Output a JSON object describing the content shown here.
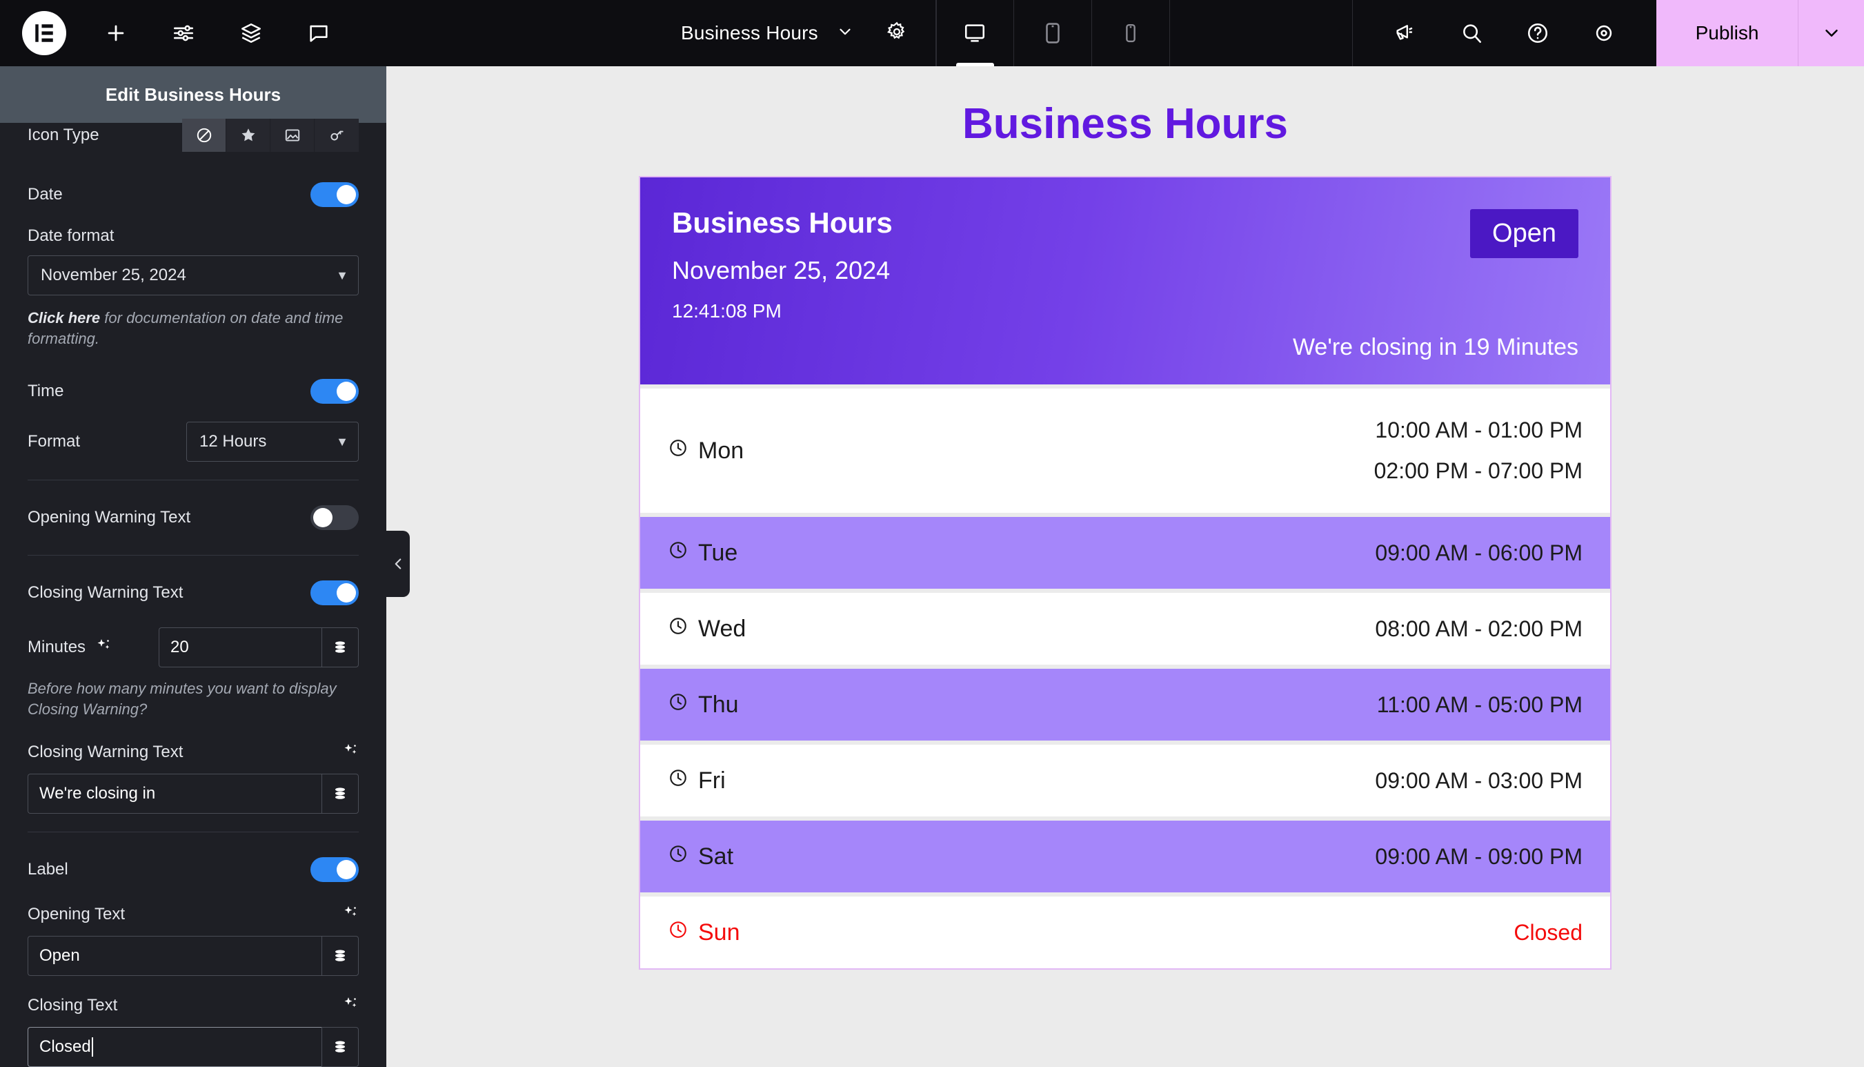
{
  "topbar": {
    "logo_icon": "elementor-logo-icon",
    "left_icons": [
      {
        "name": "add-element-icon",
        "glyph": "plus"
      },
      {
        "name": "site-settings-icon",
        "glyph": "sliders"
      },
      {
        "name": "navigator-layers-icon",
        "glyph": "layers"
      },
      {
        "name": "comments-icon",
        "glyph": "speech-bubble"
      }
    ],
    "document_name": "Business Hours",
    "document_caret_icon": "chevron-down-icon",
    "settings_icon": "gear-icon",
    "devices": [
      {
        "name": "desktop",
        "icon": "desktop-icon",
        "active": true
      },
      {
        "name": "tablet",
        "icon": "tablet-icon",
        "active": false
      },
      {
        "name": "mobile",
        "icon": "mobile-icon",
        "active": false
      }
    ],
    "utilities": [
      {
        "name": "whats-new-icon",
        "glyph": "megaphone"
      },
      {
        "name": "finder-search-icon",
        "glyph": "magnifier"
      },
      {
        "name": "help-icon",
        "glyph": "question-circle"
      },
      {
        "name": "preview-changes-icon",
        "glyph": "eye"
      }
    ],
    "publish_label": "Publish",
    "publish_caret_icon": "chevron-down-icon",
    "publish_color": "#f0b9fb"
  },
  "panel": {
    "title": "Edit Business Hours",
    "collapse_icon": "chevron-left-icon",
    "icon_type": {
      "label": "Icon Type",
      "options": [
        {
          "name": "none",
          "icon": "ban-icon",
          "active": true
        },
        {
          "name": "star",
          "icon": "star-icon",
          "active": false
        },
        {
          "name": "image",
          "icon": "image-icon",
          "active": false
        },
        {
          "name": "svg",
          "icon": "svg-icon",
          "active": false
        }
      ]
    },
    "date": {
      "label": "Date",
      "enabled": true,
      "format_label": "Date format",
      "format_value": "November 25, 2024",
      "note_link": "Click here",
      "note_rest": " for documentation on date and time formatting."
    },
    "time": {
      "label": "Time",
      "enabled": true,
      "format_label": "Format",
      "format_value": "12 Hours"
    },
    "opening_warning": {
      "label": "Opening Warning Text",
      "enabled": false
    },
    "closing_warning": {
      "label": "Closing Warning Text",
      "enabled": true,
      "minutes_label": "Minutes",
      "minutes_value": "20",
      "minutes_note": "Before how many minutes you want to display Closing Warning?",
      "text_label": "Closing Warning Text",
      "text_value": "We're closing in"
    },
    "label_group": {
      "label": "Label",
      "enabled": true,
      "opening_label": "Opening Text",
      "opening_value": "Open",
      "closing_label": "Closing Text",
      "closing_value": "Closed"
    },
    "dynamic_tag_icon": "database-stack-icon",
    "ai_icon": "ai-sparkle-icon"
  },
  "preview": {
    "page_title": "Business Hours",
    "card": {
      "title": "Business Hours",
      "date": "November 25, 2024",
      "time": "12:41:08 PM",
      "status_badge": "Open",
      "warning": "We're closing in 19 Minutes",
      "gradient_from": "#5b27d6",
      "gradient_to": "#9b79f7"
    },
    "row_accent_color": "#a586fa",
    "closed_color": "#f40c0c",
    "clock_icon": "clock-icon",
    "days": [
      {
        "day": "Mon",
        "times": [
          "10:00 AM - 01:00 PM",
          "02:00 PM - 07:00 PM"
        ],
        "style": "light",
        "closed": false
      },
      {
        "day": "Tue",
        "times": [
          "09:00 AM - 06:00 PM"
        ],
        "style": "accent",
        "closed": false
      },
      {
        "day": "Wed",
        "times": [
          "08:00 AM - 02:00 PM"
        ],
        "style": "light",
        "closed": false
      },
      {
        "day": "Thu",
        "times": [
          "11:00 AM - 05:00 PM"
        ],
        "style": "accent",
        "closed": false
      },
      {
        "day": "Fri",
        "times": [
          "09:00 AM - 03:00 PM"
        ],
        "style": "light",
        "closed": false
      },
      {
        "day": "Sat",
        "times": [
          "09:00 AM - 09:00 PM"
        ],
        "style": "accent",
        "closed": false
      },
      {
        "day": "Sun",
        "times": [
          "Closed"
        ],
        "style": "light",
        "closed": true
      }
    ]
  }
}
